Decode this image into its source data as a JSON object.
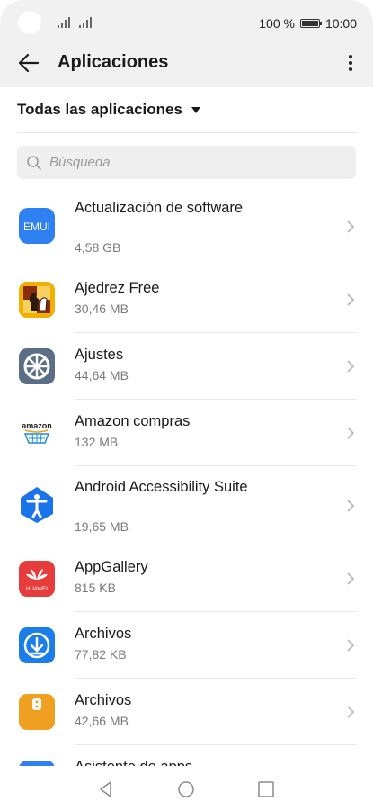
{
  "status_bar": {
    "battery": "100 %",
    "time": "10:00"
  },
  "app_bar": {
    "title": "Aplicaciones",
    "back_icon": "arrow-left-icon",
    "more_icon": "more-vertical-icon"
  },
  "filter": {
    "label": "Todas las aplicaciones"
  },
  "search": {
    "placeholder": "Búsqueda"
  },
  "apps": [
    {
      "name": "Actualización de software",
      "size": "4,58 GB",
      "icon": "emui-icon",
      "icon_text": "EMUI",
      "color": "#2f80f0"
    },
    {
      "name": "Ajedrez Free",
      "size": "30,46 MB",
      "icon": "chess-icon",
      "color": "#f0b000"
    },
    {
      "name": "Ajustes",
      "size": "44,64 MB",
      "icon": "gear-icon",
      "color": "#5c6e86"
    },
    {
      "name": "Amazon compras",
      "size": "132 MB",
      "icon": "amazon-icon",
      "icon_text": "amazon",
      "color": "#1c8fd6"
    },
    {
      "name": "Android Accessibility Suite",
      "size": "19,65 MB",
      "icon": "accessibility-icon",
      "color": "#1a73e8"
    },
    {
      "name": "AppGallery",
      "size": "815 KB",
      "icon": "appgallery-icon",
      "icon_text": "HUAWEI",
      "color": "#e63c3c"
    },
    {
      "name": "Archivos",
      "size": "77,82 KB",
      "icon": "download-icon",
      "color": "#1a7de8"
    },
    {
      "name": "Archivos",
      "size": "42,66 MB",
      "icon": "files-icon",
      "color": "#f0a020"
    },
    {
      "name": "Asistente de apps",
      "size": "",
      "icon": "app-assistant-icon",
      "color": "#2f80f0"
    }
  ]
}
